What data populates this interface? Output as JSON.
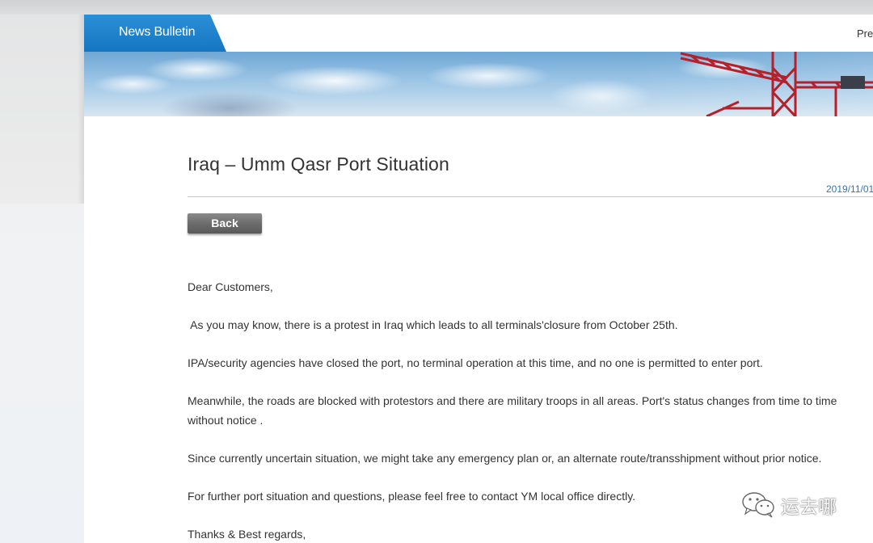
{
  "header": {
    "tab_label": "News Bulletin",
    "prev_link": "Pre"
  },
  "article": {
    "title": "Iraq – Umm Qasr Port Situation",
    "date": "2019/11/01",
    "back_label": "Back",
    "paragraphs": [
      "Dear Customers,",
      " As you may know, there is a protest in Iraq which leads to all terminals'closure from October 25th.",
      "IPA/security agencies have closed the port, no terminal operation at this time, and no one is permitted to enter port.",
      "Meanwhile, the roads are blocked with protestors and there are military troops in all areas.  Port's status changes from time to time without notice .",
      "Since currently uncertain situation, we might  take any emergency plan or, an alternate route/transshipment without prior notice.",
      "For further port situation and questions, please feel free to contact YM local office directly.",
      "Thanks & Best regards,"
    ]
  },
  "watermark": {
    "text": "运去哪",
    "icon": "wechat-icon"
  },
  "colors": {
    "tab_blue": "#1a7ec8",
    "date_blue": "#2a78b8",
    "button_gray": "#6a6a6a",
    "text": "#333333"
  }
}
